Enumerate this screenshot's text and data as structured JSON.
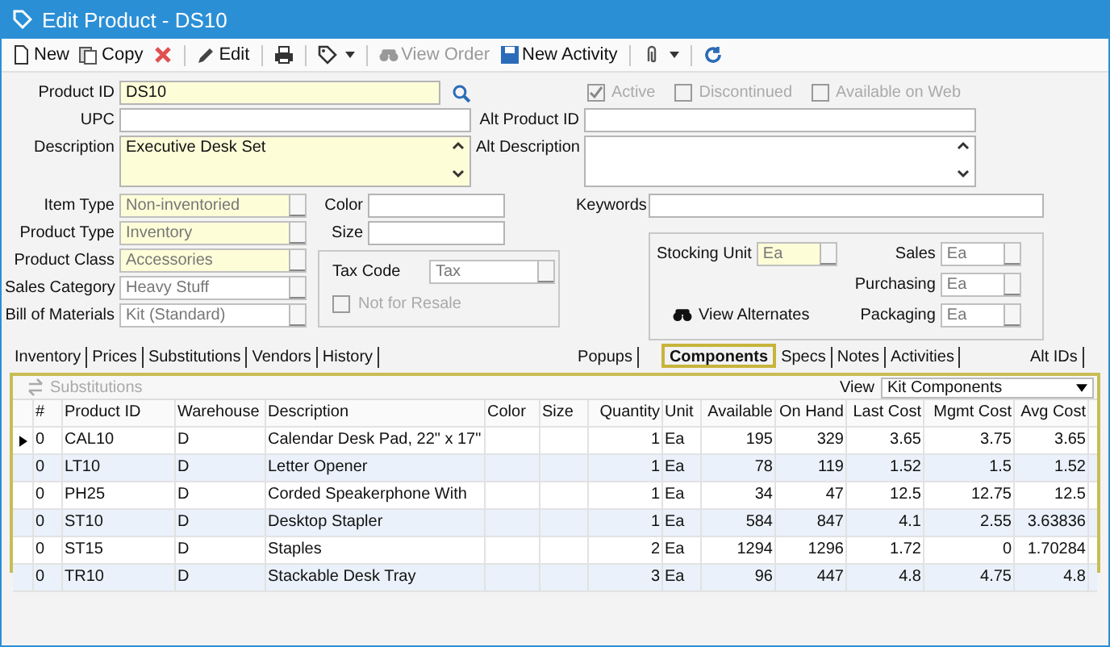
{
  "window": {
    "title": "Edit Product - DS10"
  },
  "toolbar": [
    {
      "label": "New",
      "disabled": false
    },
    {
      "label": "Copy",
      "disabled": false
    },
    {
      "label": "Edit",
      "disabled": false
    },
    {
      "label": "View Order",
      "disabled": true
    },
    {
      "label": "New Activity",
      "disabled": false
    }
  ],
  "product_id": {
    "label": "Product ID",
    "value": "DS10",
    "required": true
  },
  "upc": {
    "label": "UPC",
    "required": false
  },
  "description": {
    "label": "Description",
    "value": "Executive Desk Set",
    "required": true
  },
  "flags": [
    {
      "label": "Active",
      "checked": true,
      "disabled": true
    },
    {
      "label": "Discontinued",
      "checked": false,
      "disabled": true
    },
    {
      "label": "Available on Web",
      "checked": false,
      "disabled": true
    }
  ],
  "alt_product_id": {
    "label": "Alt Product ID"
  },
  "alt_description": {
    "label": "Alt Description"
  },
  "lookups": [
    {
      "label": "Item Type",
      "value": "Non-inventoried",
      "required": true
    },
    {
      "label": "Product Type",
      "value": "Inventory",
      "required": true
    },
    {
      "label": "Product Class",
      "value": "Accessories",
      "required": true
    },
    {
      "label": "Sales Category",
      "value": "Heavy Stuff",
      "required": false
    },
    {
      "label": "Bill of Materials",
      "value": "Kit (Standard)",
      "required": false
    }
  ],
  "color": {
    "label": "Color"
  },
  "size": {
    "label": "Size"
  },
  "tax": {
    "label": "Tax Code",
    "value": "Tax",
    "not_for_resale": {
      "label": "Not for Resale",
      "checked": false,
      "disabled": true
    }
  },
  "keywords": {
    "label": "Keywords"
  },
  "units": {
    "view_alternates": "View Alternates",
    "fields": [
      {
        "label": "Stocking Unit",
        "value": "Ea",
        "required": true
      },
      {
        "label": "Sales",
        "value": "Ea",
        "required": false
      },
      {
        "label": "Purchasing",
        "value": "Ea",
        "required": false
      },
      {
        "label": "Packaging",
        "value": "Ea",
        "required": false
      }
    ]
  },
  "tab_groups": [
    [
      {
        "label": "Inventory",
        "selected": false
      },
      {
        "label": "Prices",
        "selected": false
      },
      {
        "label": "Substitutions",
        "selected": false
      },
      {
        "label": "Vendors",
        "selected": false
      },
      {
        "label": "History",
        "selected": false
      }
    ],
    [
      {
        "label": "Popups",
        "selected": false
      }
    ],
    [
      {
        "label": "Components",
        "selected": true
      },
      {
        "label": "Specs",
        "selected": false
      },
      {
        "label": "Notes",
        "selected": false
      },
      {
        "label": "Activities",
        "selected": false
      }
    ],
    [
      {
        "label": "Alt IDs",
        "selected": false
      }
    ]
  ],
  "components": {
    "substitutions_button": {
      "label": "Substitutions",
      "disabled": true
    },
    "view_label": "View",
    "view_value": "Kit Components",
    "columns": [
      {
        "label": "#",
        "kind": "text"
      },
      {
        "label": "Product ID",
        "kind": "text"
      },
      {
        "label": "Warehouse",
        "kind": "text"
      },
      {
        "label": "Description",
        "kind": "text"
      },
      {
        "label": "Color",
        "kind": "text"
      },
      {
        "label": "Size",
        "kind": "text"
      },
      {
        "label": "Quantity",
        "kind": "number"
      },
      {
        "label": "Unit",
        "kind": "text"
      },
      {
        "label": "Available",
        "kind": "number"
      },
      {
        "label": "On Hand",
        "kind": "number"
      },
      {
        "label": "Last Cost",
        "kind": "number"
      },
      {
        "label": "Mgmt Cost",
        "kind": "number"
      },
      {
        "label": "Avg Cost",
        "kind": "number"
      }
    ],
    "rows": [
      {
        "selected": true,
        "cells": [
          "0",
          "CAL10",
          "D",
          "Calendar Desk Pad, 22\" x 17\"",
          "",
          "",
          "1",
          "Ea",
          "195",
          "329",
          "3.65",
          "3.75",
          "3.65"
        ]
      },
      {
        "selected": false,
        "cells": [
          "0",
          "LT10",
          "D",
          "Letter Opener",
          "",
          "",
          "1",
          "Ea",
          "78",
          "119",
          "1.52",
          "1.5",
          "1.52"
        ]
      },
      {
        "selected": false,
        "cells": [
          "0",
          "PH25",
          "D",
          "Corded Speakerphone With",
          "",
          "",
          "1",
          "Ea",
          "34",
          "47",
          "12.5",
          "12.75",
          "12.5"
        ]
      },
      {
        "selected": false,
        "cells": [
          "0",
          "ST10",
          "D",
          "Desktop Stapler",
          "",
          "",
          "1",
          "Ea",
          "584",
          "847",
          "4.1",
          "2.55",
          "3.63836"
        ]
      },
      {
        "selected": false,
        "cells": [
          "0",
          "ST15",
          "D",
          "Staples",
          "",
          "",
          "2",
          "Ea",
          "1294",
          "1296",
          "1.72",
          "0",
          "1.70284"
        ]
      },
      {
        "selected": false,
        "cells": [
          "0",
          "TR10",
          "D",
          "Stackable Desk Tray",
          "",
          "",
          "3",
          "Ea",
          "96",
          "447",
          "4.8",
          "4.75",
          "4.8"
        ]
      }
    ]
  }
}
